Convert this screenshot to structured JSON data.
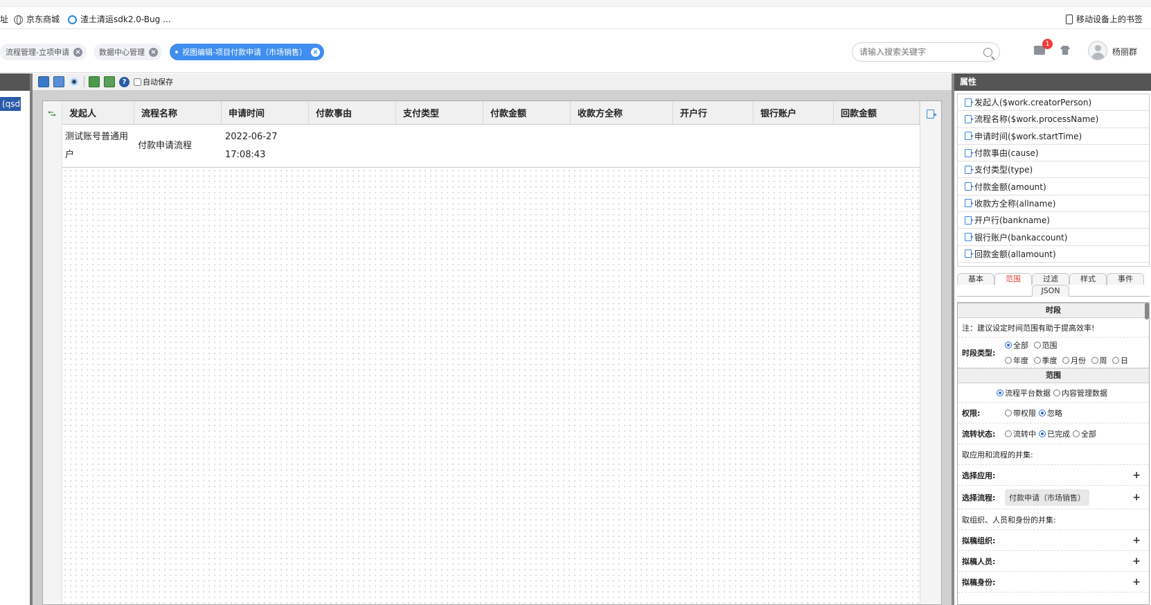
{
  "bookmarks": {
    "items": [
      {
        "label": "址",
        "icon": "none"
      },
      {
        "label": "京东商城",
        "icon": "globe-icon"
      },
      {
        "label": "渣土清运sdk2.0-Bug ...",
        "icon": "ring-icon"
      }
    ],
    "mobile_label": "移动设备上的书签"
  },
  "tabs": [
    {
      "label": "流程管理-立项申请",
      "active": false
    },
    {
      "label": "数据中心管理",
      "active": false
    },
    {
      "label": "视图编辑-项目付款申请（市场销售）",
      "active": true
    }
  ],
  "header": {
    "search_placeholder": "请输入搜索关键字",
    "badge_count": "1",
    "username": "杨丽群"
  },
  "left": {
    "selected_label": "(qsd"
  },
  "toolbar": {
    "autosave_label": "自动保存",
    "help_glyph": "?"
  },
  "table": {
    "columns": [
      "发起人",
      "流程名称",
      "申请时间",
      "付款事由",
      "支付类型",
      "付款金额",
      "收款方全称",
      "开户行",
      "银行账户",
      "回款金额"
    ],
    "row": {
      "initiator": "测试账号普通用户",
      "process_name": "付款申请流程",
      "apply_date": "2022-06-27",
      "apply_time": "17:08:43"
    }
  },
  "props": {
    "title": "属性",
    "fields": [
      "发起人($work.creatorPerson)",
      "流程名称($work.processName)",
      "申请时间($work.startTime)",
      "付款事由(cause)",
      "支付类型(type)",
      "付款金额(amount)",
      "收款方全称(allname)",
      "开户行(bankname)",
      "银行账户(bankaccount)",
      "回款金额(allamount)"
    ],
    "tabs": [
      "基本",
      "范围",
      "过滤",
      "样式",
      "事件",
      "JSON"
    ],
    "active_tab": "范围",
    "scope": {
      "period_title": "时段",
      "note": "注：建议设定时间范围有助于提高效率!",
      "period_type_label": "时段类型:",
      "period_opts_1": [
        "全部",
        "范围"
      ],
      "period_opts_2": [
        "年度",
        "季度",
        "月份",
        "周",
        "日"
      ],
      "range_title": "范围",
      "source_opts": [
        "流程平台数据",
        "内容管理数据"
      ],
      "perm_label": "权限:",
      "perm_opts": [
        "带权限",
        "忽略"
      ],
      "flow_label": "流转状态:",
      "flow_opts": [
        "流转中",
        "已完成",
        "全部"
      ],
      "union_apps": "取应用和流程的并集:",
      "select_app": "选择应用:",
      "select_flow": "选择流程:",
      "selected_flow": "付款申请（市场销售）",
      "union_org": "取组织、人员和身份的并集:",
      "draft_org": "拟稿组织:",
      "draft_person": "拟稿人员:",
      "draft_identity": "拟稿身份:"
    }
  }
}
